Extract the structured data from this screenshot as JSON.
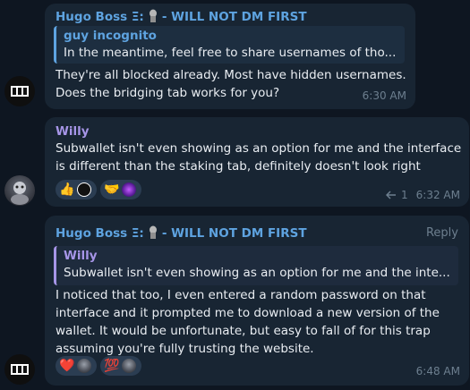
{
  "messages": [
    {
      "sender": "Hugo Boss Ξ:",
      "sender_suffix": "- WILL NOT DM FIRST",
      "reply": {
        "name": "guy incognito",
        "text": "In the meantime, feel free to share usernames of tho..."
      },
      "text": "They're all blocked already. Most have hidden usernames.\nDoes the bridging tab works for you?",
      "time": "6:30 AM"
    },
    {
      "sender": "Willy",
      "text": "Subwallet isn't even showing as an option for me and the interface\nis different than the staking tab, definitely doesn't look right",
      "reactions": [
        {
          "emoji": "👍",
          "icon": "thumbs-up-icon"
        },
        {
          "emoji": "🤝",
          "icon": "handshake-icon"
        }
      ],
      "reply_count": "1",
      "time": "6:32 AM"
    },
    {
      "sender": "Hugo Boss Ξ:",
      "sender_suffix": "- WILL NOT DM FIRST",
      "reply_action": "Reply",
      "reply": {
        "name": "Willy",
        "text": "Subwallet isn't even showing as an option for me and the inte..."
      },
      "text": "I noticed that too, I even entered a random password on that\ninterface and it prompted me to download a new version of the\nwallet. It would be unfortunate, but easy to fall of for this trap\nassuming you're fully trusting the website.",
      "reactions": [
        {
          "emoji": "❤️",
          "icon": "heart-icon"
        },
        {
          "emoji": "💯",
          "icon": "hundred-points-icon"
        }
      ],
      "time": "6:48 AM"
    }
  ],
  "colors": {
    "background": "#0e1621",
    "bubble": "#182533",
    "hugo_name": "#5ea3e0",
    "willy_name": "#a695e7",
    "meta": "#6d7f8f"
  }
}
